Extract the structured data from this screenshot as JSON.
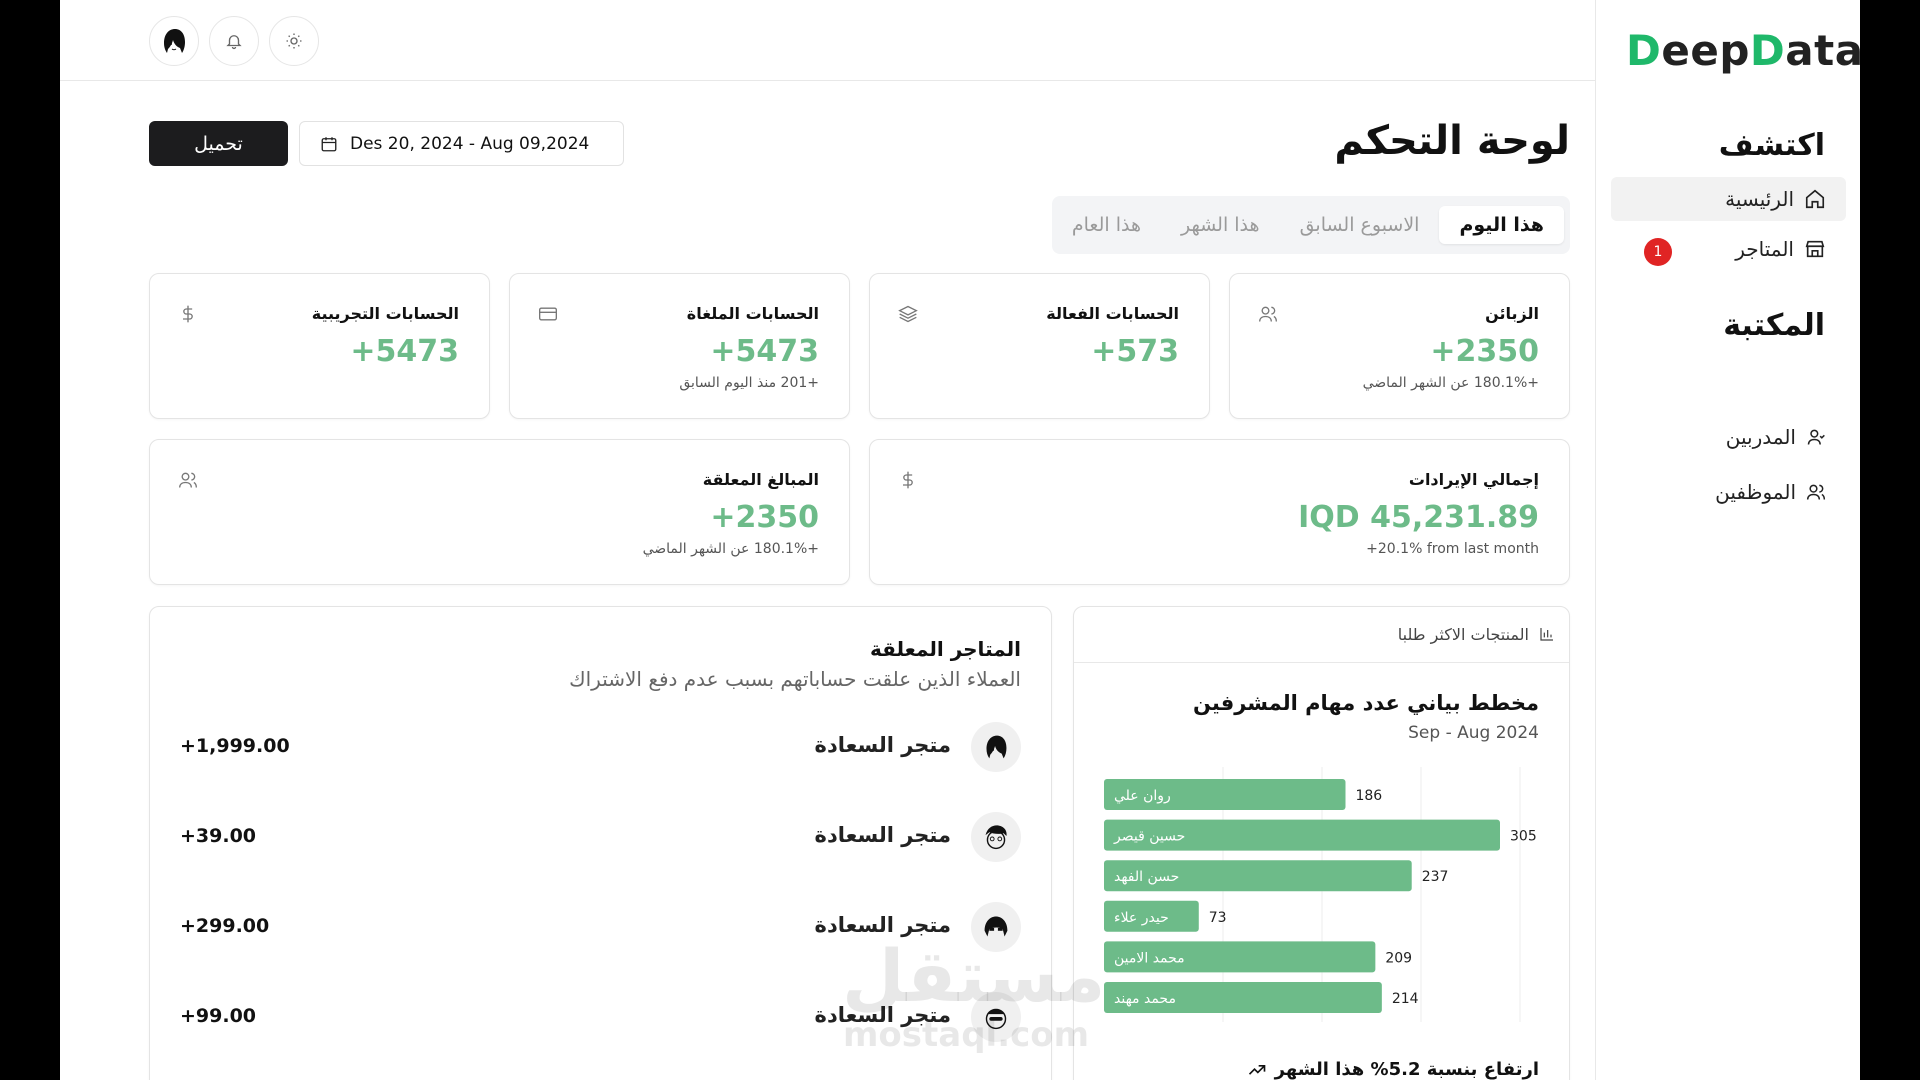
{
  "sidebar": {
    "logo_part1": "D",
    "logo_part2": "eep",
    "logo_part3": "D",
    "logo_part4": "ata",
    "explore_heading": "اكتشف",
    "library_heading": "المكتبة",
    "items": [
      {
        "label": "الرئيسية",
        "icon": "home-icon"
      },
      {
        "label": "المتاجر",
        "icon": "store-icon",
        "badge": "1"
      },
      {
        "label": "المدربين",
        "icon": "user-icon"
      },
      {
        "label": "الموظفين",
        "icon": "users-icon"
      }
    ]
  },
  "header": {
    "title": "لوحة التحكم",
    "download_label": "تحميل",
    "date_range": "Des 20, 2024 - Aug 09,2024"
  },
  "tabs": [
    {
      "label": "هذا اليوم",
      "active": true
    },
    {
      "label": "الاسبوع السابق",
      "active": false
    },
    {
      "label": "هذا الشهر",
      "active": false
    },
    {
      "label": "هذا العام",
      "active": false
    }
  ],
  "stats": [
    {
      "title": "الزبائن",
      "value": "+2350",
      "sub": "+180.1% عن الشهر الماضي",
      "icon": "users-icon"
    },
    {
      "title": "الحسابات الفعالة",
      "value": "+573",
      "sub": "",
      "icon": "layers-icon"
    },
    {
      "title": "الحسابات الملغاة",
      "value": "+5473",
      "sub": "+201 منذ اليوم السابق",
      "icon": "card-icon"
    },
    {
      "title": "الحسابات التجريبية",
      "value": "+5473",
      "sub": "",
      "icon": "dollar-icon"
    },
    {
      "title": "إجمالي الإيرادات",
      "value": "IQD 45,231.89",
      "sub": "+20.1% from last month",
      "icon": "dollar-icon"
    },
    {
      "title": "المبالغ المعلقة",
      "value": "+2350",
      "sub": "+180.1% عن الشهر الماضي",
      "icon": "users-icon"
    }
  ],
  "suspended_stores": {
    "title": "المتاجر المعلقة",
    "subtitle": "العملاء الذين علقت حساباتهم بسبب عدم دفع الاشتراك",
    "rows": [
      {
        "name": "متجر السعادة",
        "amount": "+1,999.00"
      },
      {
        "name": "متجر السعادة",
        "amount": "+39.00"
      },
      {
        "name": "متجر السعادة",
        "amount": "+299.00"
      },
      {
        "name": "متجر السعادة",
        "amount": "+99.00"
      }
    ]
  },
  "top_products": {
    "header_label": "المنتجات الاكثر طلبا",
    "title": "مخطط بياني عدد مهام المشرفين",
    "subtitle": "Sep - Aug 2024",
    "footer": "ارتفاع بنسبة 5.2% هذا الشهر"
  },
  "chart_data": {
    "type": "bar",
    "orientation": "horizontal",
    "categories": [
      "روان علي",
      "حسين قيصر",
      "حسن الفهد",
      "حيدر علاء",
      "محمد الامين",
      "محمد مهند"
    ],
    "values": [
      186,
      305,
      237,
      73,
      209,
      214
    ],
    "xlim": [
      0,
      305
    ],
    "bar_color": "#6dbb89",
    "grid": true
  },
  "watermark": {
    "arabic": "مستقل",
    "latin": "mostaql.com"
  },
  "colors": {
    "accent": "#6dbb89",
    "brand_green": "#1fb86a",
    "badge_red": "#e02424",
    "dark_button": "#1c1c1e"
  }
}
